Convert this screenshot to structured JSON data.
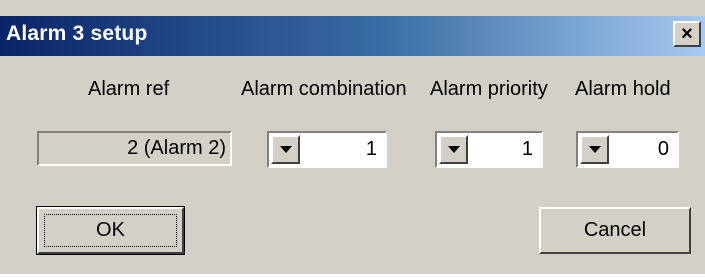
{
  "window": {
    "title": "Alarm 3 setup",
    "close_glyph": "×"
  },
  "columns": {
    "alarm_ref_label": "Alarm ref",
    "alarm_combination_label": "Alarm combination",
    "alarm_priority_label": "Alarm priority",
    "alarm_hold_label": "Alarm hold"
  },
  "fields": {
    "alarm_ref_value": "2 (Alarm 2)",
    "alarm_combination_value": "1",
    "alarm_priority_value": "1",
    "alarm_hold_value": "0"
  },
  "buttons": {
    "ok_label": "OK",
    "cancel_label": "Cancel"
  },
  "icons": {
    "close": "close-icon",
    "dropdown": "triangle-down-icon"
  },
  "colors": {
    "title_gradient_start": "#0a246a",
    "title_gradient_end": "#a6caf0",
    "dialog_face": "#d4d0c8"
  }
}
